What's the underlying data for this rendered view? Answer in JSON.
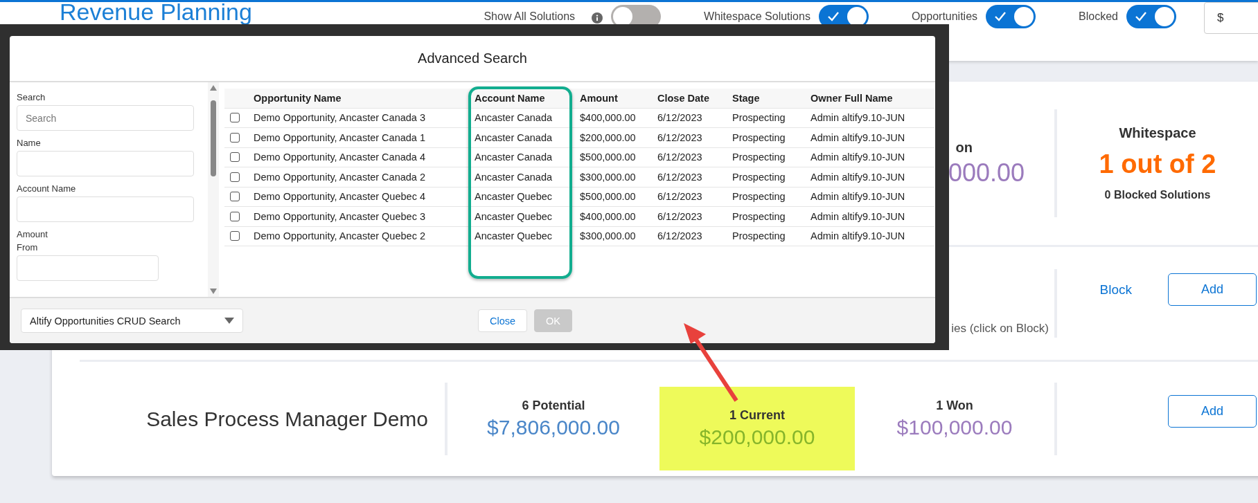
{
  "page": {
    "title": "Revenue Planning",
    "toggles": [
      {
        "label": "Show All Solutions",
        "info": true,
        "on": false
      },
      {
        "label": "Whitespace Solutions",
        "info": false,
        "on": true
      },
      {
        "label": "Opportunities",
        "info": false,
        "on": true
      },
      {
        "label": "Blocked",
        "info": false,
        "on": true
      }
    ],
    "currency_field": {
      "value": "$"
    }
  },
  "solutions": [
    {
      "kind": "summary",
      "won_label": "on",
      "won_value": "000.00",
      "whitespace_label": "Whitespace",
      "whitespace_value": "1 out of 2",
      "blocked_label": "0 Blocked Solutions"
    },
    {
      "kind": "block",
      "note": "ies (click on Block)",
      "block_link": "Block",
      "add_button": "Add"
    },
    {
      "kind": "solution",
      "name": "Sales Process Manager Demo",
      "add_button": "Add",
      "stats": [
        {
          "label": "6 Potential",
          "value": "$7,806,000.00",
          "color": "#4a86c8",
          "highlighted": false
        },
        {
          "label": "1 Current",
          "value": "$200,000.00",
          "color": "#86b52b",
          "highlighted": true
        },
        {
          "label": "1 Won",
          "value": "$100,000.00",
          "color": "#9b7bbd",
          "highlighted": false
        }
      ]
    }
  ],
  "modal": {
    "title": "Advanced Search",
    "filters": [
      {
        "kind": "text",
        "label": "Search",
        "placeholder": "Search"
      },
      {
        "kind": "text",
        "label": "Name"
      },
      {
        "kind": "text",
        "label": "Account Name"
      },
      {
        "kind": "range",
        "label": "Amount",
        "sublabel": "From"
      }
    ],
    "table": {
      "columns": [
        "Opportunity Name",
        "Account Name",
        "Amount",
        "Close Date",
        "Stage",
        "Owner Full Name"
      ],
      "rows": [
        {
          "checked": false,
          "cells": [
            "Demo Opportunity, Ancaster Canada 3",
            "Ancaster Canada",
            "$400,000.00",
            "6/12/2023",
            "Prospecting",
            "Admin altify9.10-JUN"
          ]
        },
        {
          "checked": false,
          "cells": [
            "Demo Opportunity, Ancaster Canada 1",
            "Ancaster Canada",
            "$200,000.00",
            "6/12/2023",
            "Prospecting",
            "Admin altify9.10-JUN"
          ]
        },
        {
          "checked": false,
          "cells": [
            "Demo Opportunity, Ancaster Canada 4",
            "Ancaster Canada",
            "$500,000.00",
            "6/12/2023",
            "Prospecting",
            "Admin altify9.10-JUN"
          ]
        },
        {
          "checked": false,
          "cells": [
            "Demo Opportunity, Ancaster Canada 2",
            "Ancaster Canada",
            "$300,000.00",
            "6/12/2023",
            "Prospecting",
            "Admin altify9.10-JUN"
          ]
        },
        {
          "checked": false,
          "cells": [
            "Demo Opportunity, Ancaster Quebec 4",
            "Ancaster Quebec",
            "$500,000.00",
            "6/12/2023",
            "Prospecting",
            "Admin altify9.10-JUN"
          ]
        },
        {
          "checked": false,
          "cells": [
            "Demo Opportunity, Ancaster Quebec 3",
            "Ancaster Quebec",
            "$400,000.00",
            "6/12/2023",
            "Prospecting",
            "Admin altify9.10-JUN"
          ]
        },
        {
          "checked": false,
          "cells": [
            "Demo Opportunity, Ancaster Quebec 2",
            "Ancaster Quebec",
            "$300,000.00",
            "6/12/2023",
            "Prospecting",
            "Admin altify9.10-JUN"
          ]
        }
      ]
    },
    "search_layout": {
      "value": "Altify Opportunities CRUD Search"
    },
    "buttons": [
      {
        "label": "Close",
        "disabled": false
      },
      {
        "label": "OK",
        "disabled": true
      }
    ]
  },
  "annotations": {
    "column_outline": true,
    "pointer_arrow": true
  }
}
